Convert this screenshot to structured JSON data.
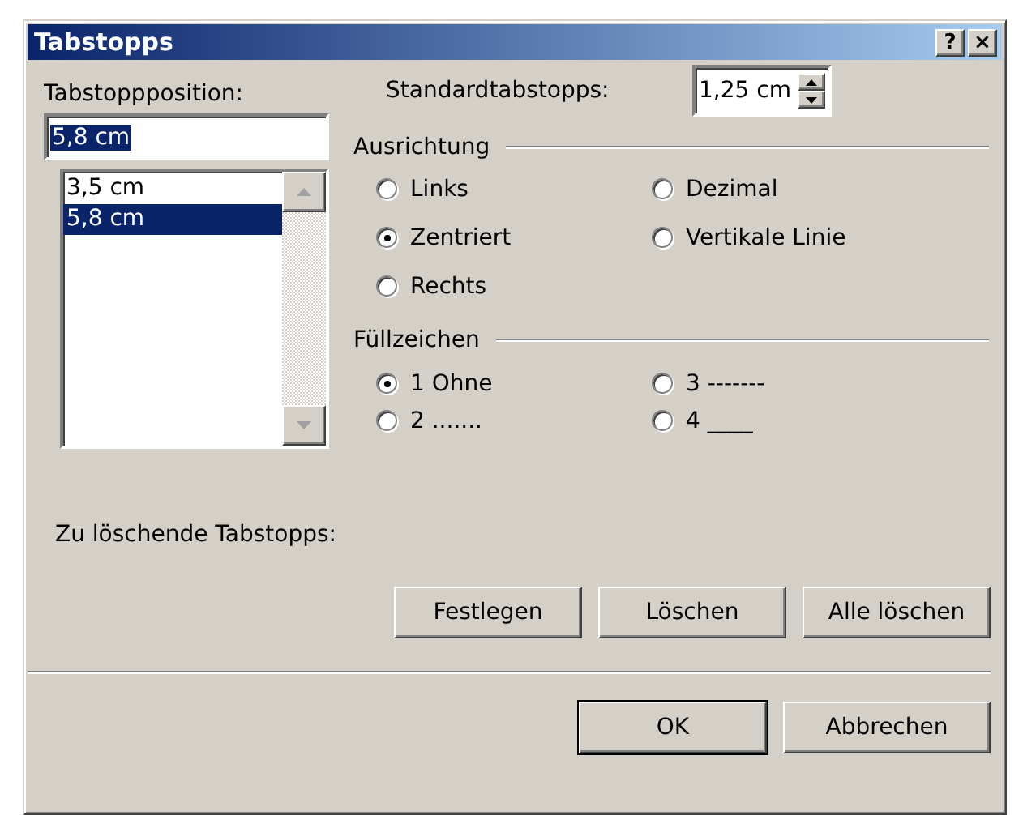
{
  "window": {
    "title": "Tabstopps",
    "help_button": "?",
    "close_button": "×"
  },
  "tab_position": {
    "label": "Tabstoppposition:",
    "value": "5,8 cm",
    "value_selected": true
  },
  "positions": [
    {
      "text": "3,5 cm",
      "selected": false
    },
    {
      "text": "5,8 cm",
      "selected": true
    }
  ],
  "default_tabs": {
    "label": "Standardtabstopps:",
    "value": "1,25 cm"
  },
  "alignment": {
    "title": "Ausrichtung",
    "options": [
      {
        "label": "Links",
        "selected": false
      },
      {
        "label": "Dezimal",
        "selected": false
      },
      {
        "label": "Zentriert",
        "selected": true
      },
      {
        "label": "Vertikale Linie",
        "selected": false
      },
      {
        "label": "Rechts",
        "selected": false
      }
    ]
  },
  "leader": {
    "title": "Füllzeichen",
    "options": [
      {
        "label": "1 Ohne",
        "selected": true
      },
      {
        "label": "3 -------",
        "selected": false
      },
      {
        "label": "2 .......",
        "selected": false
      },
      {
        "label": "4 ____",
        "selected": false
      }
    ]
  },
  "to_delete_label": "Zu löschende Tabstopps:",
  "action_buttons": [
    "Festlegen",
    "Löschen",
    "Alle löschen"
  ],
  "dialog_buttons": [
    {
      "label": "OK",
      "default": true
    },
    {
      "label": "Abbrechen",
      "default": false
    }
  ]
}
